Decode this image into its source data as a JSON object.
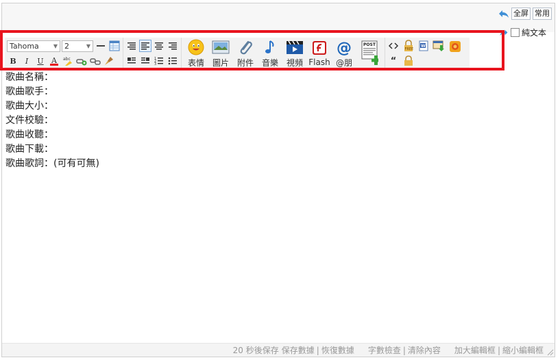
{
  "topbar": {
    "fullscreen_label": "全屏",
    "common_label": "常用",
    "plain_text_label": "純文本"
  },
  "toolbar": {
    "font_family": "Tahoma",
    "font_size": "2",
    "big_buttons": [
      {
        "name": "emoticon",
        "label": "表情"
      },
      {
        "name": "image",
        "label": "圖片"
      },
      {
        "name": "attachment",
        "label": "附件"
      },
      {
        "name": "music",
        "label": "音樂"
      },
      {
        "name": "video",
        "label": "視頻"
      },
      {
        "name": "flash",
        "label": "Flash"
      },
      {
        "name": "mention",
        "label": "@朋"
      }
    ]
  },
  "content": {
    "lines": [
      "歌曲名稱：",
      "歌曲歌手：",
      "歌曲大小：",
      "文件校驗：",
      "歌曲收聽：",
      "歌曲下載：",
      "歌曲歌詞：(可有可無)"
    ]
  },
  "statusbar": {
    "autosave": "20 秒後保存",
    "save_data": "保存數據",
    "restore_data": "恢復數據",
    "word_check": "字數檢查",
    "clear_content": "清除內容",
    "enlarge": "加大編輯框",
    "shrink": "縮小編輯框"
  },
  "colors": {
    "highlight_border": "#e8141e",
    "toolbar_bg": "#f2f2f2",
    "status_text": "#999999"
  }
}
